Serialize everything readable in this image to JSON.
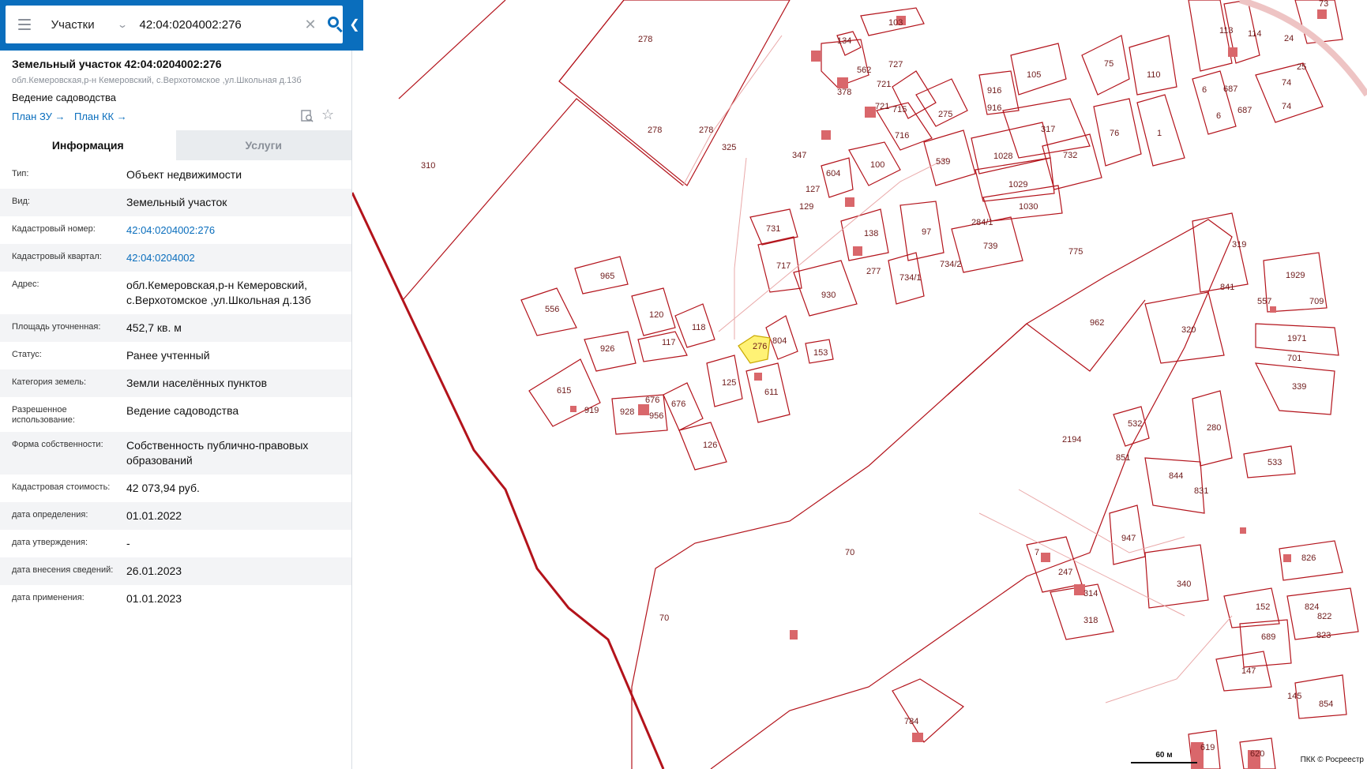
{
  "search": {
    "type_label": "Участки",
    "value": "42:04:0204002:276"
  },
  "object": {
    "title": "Земельный участок 42:04:0204002:276",
    "address": "обл.Кемеровская,р-н Кемеровский, с.Верхотомское ,ул.Школьная д.13б",
    "use": "Ведение садоводства",
    "plan_zu": "План ЗУ →",
    "plan_kk": "План КК →"
  },
  "tabs": [
    {
      "label": "Информация",
      "active": true
    },
    {
      "label": "Услуги",
      "active": false
    }
  ],
  "info": [
    {
      "label": "Тип:",
      "value": "Объект недвижимости"
    },
    {
      "label": "Вид:",
      "value": "Земельный участок"
    },
    {
      "label": "Кадастровый номер:",
      "value": "42:04:0204002:276",
      "link": true
    },
    {
      "label": "Кадастровый квартал:",
      "value": "42:04:0204002",
      "link": true
    },
    {
      "label": "Адрес:",
      "value": "обл.Кемеровская,р-н Кемеровский, с.Верхотомское ,ул.Школьная д.13б"
    },
    {
      "label": "Площадь уточненная:",
      "value": "452,7 кв. м"
    },
    {
      "label": "Статус:",
      "value": "Ранее учтенный"
    },
    {
      "label": "Категория земель:",
      "value": "Земли населённых пунктов"
    },
    {
      "label": "Разрешенное использование:",
      "value": "Ведение садоводства"
    },
    {
      "label": "Форма собственности:",
      "value": "Собственность публично-правовых образований"
    },
    {
      "label": "Кадастровая стоимость:",
      "value": "42 073,94 руб."
    },
    {
      "label": "дата определения:",
      "value": "01.01.2022"
    },
    {
      "label": "дата утверждения:",
      "value": "-"
    },
    {
      "label": "дата внесения сведений:",
      "value": "26.01.2023"
    },
    {
      "label": "дата применения:",
      "value": "01.01.2023"
    }
  ],
  "map": {
    "scale_label": "60 м",
    "copyright": "ПКК © Росреестр",
    "parcel_labels": [
      "278",
      "278",
      "278",
      "310",
      "325",
      "347",
      "562",
      "134",
      "727",
      "103",
      "378",
      "721",
      "721",
      "715",
      "716",
      "275",
      "916",
      "916",
      "105",
      "75",
      "110",
      "76",
      "1",
      "113",
      "114",
      "24",
      "73",
      "25",
      "74",
      "74",
      "6",
      "6",
      "687",
      "687",
      "604",
      "100",
      "539",
      "1028",
      "1029",
      "1030",
      "317",
      "732",
      "127",
      "129",
      "731",
      "717",
      "138",
      "97",
      "284/1",
      "739",
      "734/2",
      "277",
      "734/1",
      "775",
      "965",
      "556",
      "120",
      "118",
      "117",
      "930",
      "926",
      "276",
      "804",
      "153",
      "615",
      "919",
      "928",
      "956",
      "676",
      "676",
      "125",
      "611",
      "126",
      "962",
      "319",
      "1929",
      "841",
      "557",
      "709",
      "320",
      "1971",
      "701",
      "339",
      "2194",
      "532",
      "851",
      "280",
      "533",
      "844",
      "831",
      "70",
      "70",
      "7",
      "247",
      "947",
      "314",
      "318",
      "340",
      "826",
      "152",
      "824",
      "822",
      "689",
      "823",
      "147",
      "145",
      "854",
      "784",
      "619",
      "620"
    ],
    "highlight_label": "276"
  },
  "colors": {
    "accent": "#0a6ebd",
    "parcel_stroke": "#b3131b",
    "building_fill": "#d9676b",
    "highlight_fill": "#fff275",
    "road": "#e9a8a8"
  }
}
